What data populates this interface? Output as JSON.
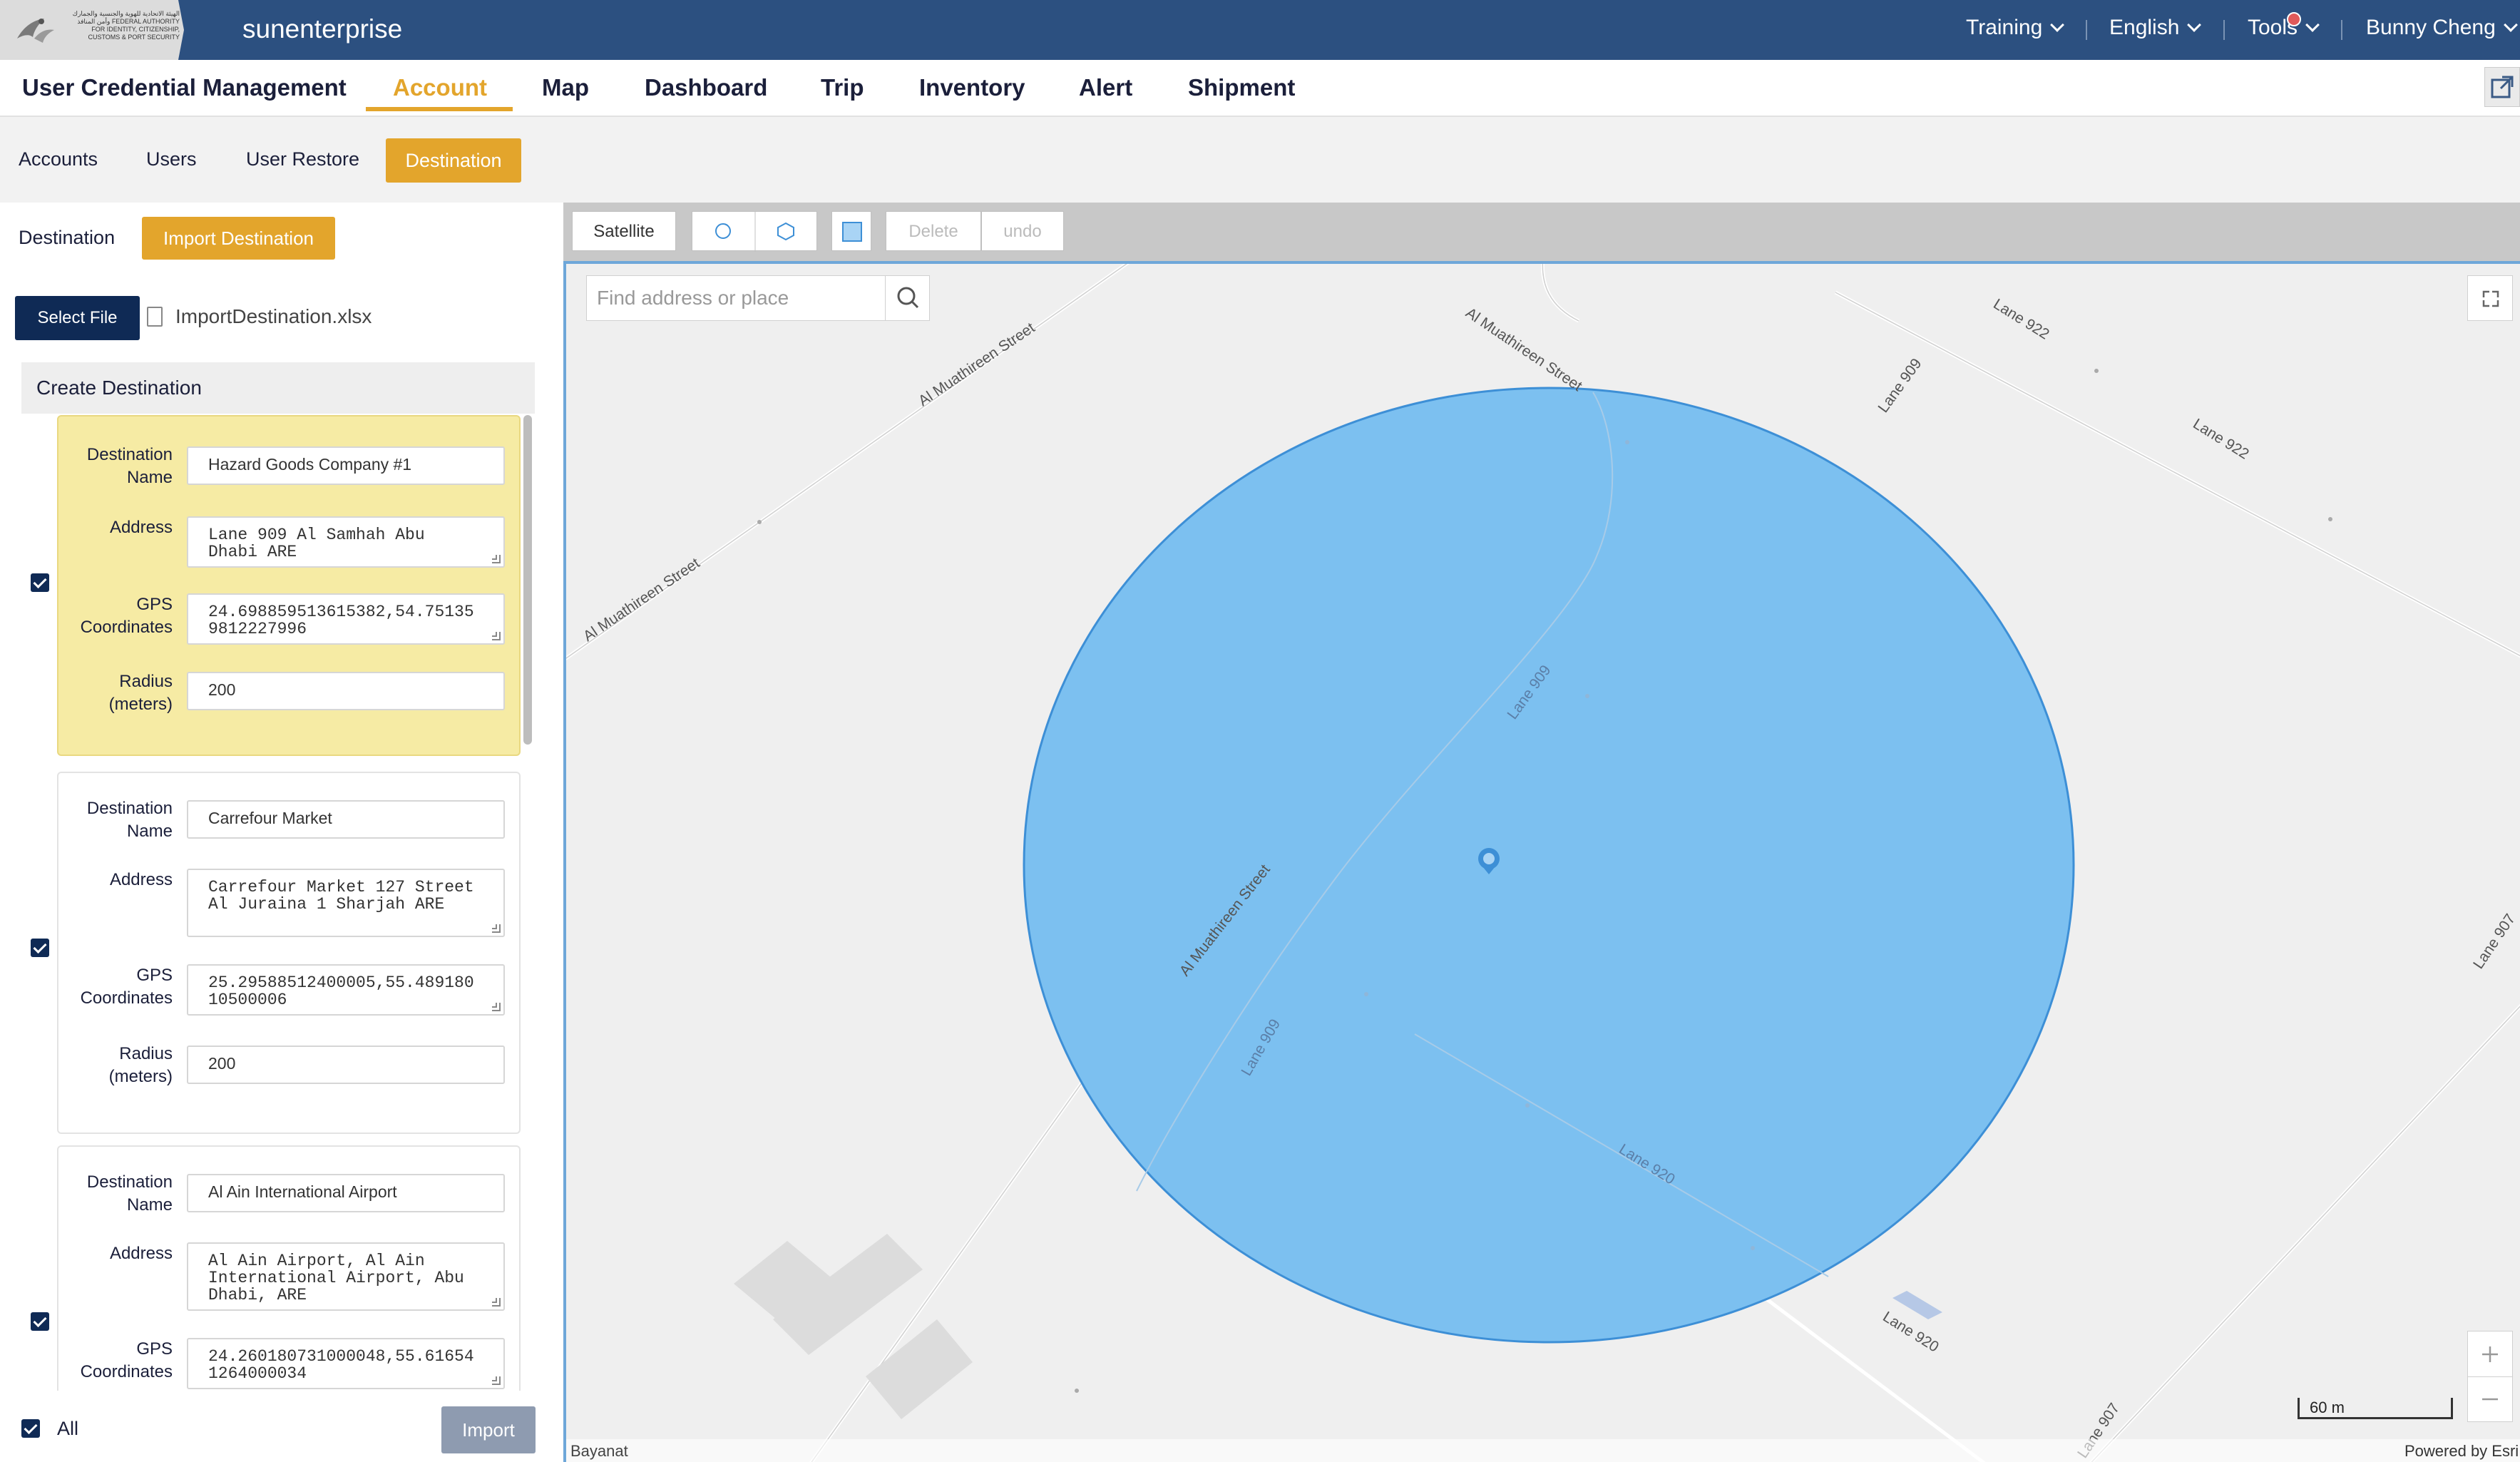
{
  "header": {
    "logo_text": "الهيئة الاتحادية للهوية والجنسية والجمارك وأمن المنافذ FEDERAL AUTHORITY FOR IDENTITY, CITIZENSHIP, CUSTOMS & PORT SECURITY",
    "brand": "sunenterprise",
    "menus": [
      {
        "label": "Training"
      },
      {
        "label": "English"
      },
      {
        "label": "Tools"
      },
      {
        "label": "Bunny Cheng"
      }
    ]
  },
  "main_nav": {
    "tabs": [
      {
        "label": "User Credential Management"
      },
      {
        "label": "Account",
        "active": true
      },
      {
        "label": "Map"
      },
      {
        "label": "Dashboard"
      },
      {
        "label": "Trip"
      },
      {
        "label": "Inventory"
      },
      {
        "label": "Alert"
      },
      {
        "label": "Shipment"
      }
    ]
  },
  "sub_nav": {
    "tabs": [
      {
        "label": "Accounts"
      },
      {
        "label": "Users"
      },
      {
        "label": "User Restore"
      },
      {
        "label": "Destination",
        "active": true
      }
    ]
  },
  "left_panel": {
    "title": "Destination",
    "import_button": "Import Destination",
    "select_file_button": "Select File",
    "file_name": "ImportDestination.xlsx",
    "section_title": "Create Destination",
    "labels": {
      "name_1": "Destination",
      "name_2": "Name",
      "address": "Address",
      "gps_1": "GPS",
      "gps_2": "Coordinates",
      "radius_1": "Radius",
      "radius_2": "(meters)"
    },
    "destinations": [
      {
        "name": "Hazard Goods Company #1",
        "address": "Lane 909 Al Samhah Abu Dhabi ARE",
        "gps": "24.698859513615382,54.751359812227996",
        "radius": "200",
        "checked": true,
        "selected": true
      },
      {
        "name": "Carrefour Market",
        "address": "Carrefour Market 127 Street Al Juraina 1 Sharjah ARE",
        "gps": "25.29588512400005,55.48918010500006",
        "radius": "200",
        "checked": true,
        "selected": false
      },
      {
        "name": "Al Ain International Airport",
        "address": "Al Ain Airport, Al Ain International Airport, Abu Dhabi, ARE",
        "gps": "24.260180731000048,55.616541264000034",
        "radius": "",
        "checked": true,
        "selected": false
      }
    ],
    "all_label": "All",
    "import_submit": "Import"
  },
  "map": {
    "toolbar": {
      "satellite": "Satellite",
      "delete": "Delete",
      "undo": "undo"
    },
    "search_placeholder": "Find address or place",
    "street_labels": {
      "muathireen_top": "Al Muathireen Street",
      "muathireen_left_a": "Al Muathireen Street",
      "muathireen_left_b": "Al Muathireen Street",
      "muathireen_bottom": "Al Muathireen Street",
      "lane922_a": "Lane 922",
      "lane922_b": "Lane 922",
      "lane909_a": "Lane 909",
      "lane909_b": "Lane 909",
      "lane909_c": "Lane 909",
      "lane920_a": "Lane 920",
      "lane920_b": "Lane 920",
      "lane907_a": "Lane 907",
      "lane907_b": "Lane 907"
    },
    "scale_label": "60 m",
    "attribution_left": "Bayanat",
    "attribution_right": "Powered by Esri",
    "colors": {
      "geofence_fill": "#7cc0f0",
      "geofence_stroke": "#3d8fd6"
    }
  }
}
